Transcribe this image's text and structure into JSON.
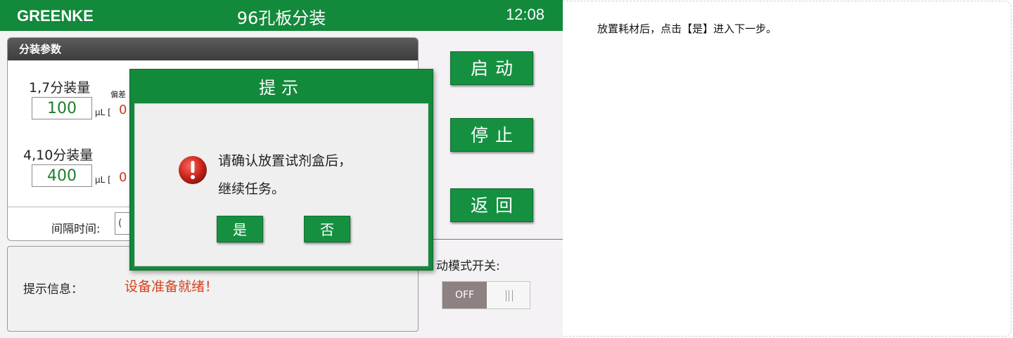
{
  "header": {
    "brand": "GREENKE",
    "title": "96孔板分装",
    "time": "12:08"
  },
  "params_panel": {
    "title": "分装参数",
    "row1": {
      "label": "1,7分装量",
      "value": "100",
      "unit": "μL [",
      "deviation_value": "0",
      "deviation_label": "偏差"
    },
    "row2": {
      "label": "4,10分装量",
      "value": "400",
      "unit": "μL [",
      "deviation_value": "0"
    },
    "interval": {
      "label": "间隔时间:",
      "value": "("
    }
  },
  "info": {
    "label": "提示信息：",
    "value": "设备准备就绪！"
  },
  "buttons": {
    "start": "启动",
    "stop": "停止",
    "back": "返回"
  },
  "mode": {
    "label": "动模式开关:",
    "toggle_state": "OFF"
  },
  "dialog": {
    "title": "提示",
    "message_line1": "请确认放置试剂盒后，",
    "message_line2": "继续任务。",
    "yes": "是",
    "no": "否",
    "icon": "warning-icon"
  },
  "note": {
    "text": "放置耗材后，点击【是】进入下一步。"
  },
  "colors": {
    "primary_green": "#13893b",
    "alert_red": "#d6401d",
    "value_green": "#1e7d2e"
  }
}
